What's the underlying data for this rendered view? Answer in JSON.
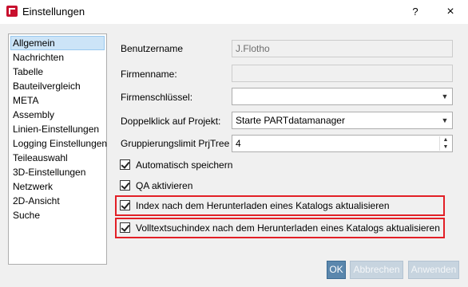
{
  "window": {
    "title": "Einstellungen",
    "help": "?",
    "close": "×"
  },
  "sidebar": {
    "items": [
      {
        "label": "Allgemein",
        "selected": true
      },
      {
        "label": "Nachrichten"
      },
      {
        "label": "Tabelle"
      },
      {
        "label": "Bauteilvergleich"
      },
      {
        "label": "META"
      },
      {
        "label": "Assembly"
      },
      {
        "label": "Linien-Einstellungen"
      },
      {
        "label": "Logging Einstellungen"
      },
      {
        "label": "Teileauswahl"
      },
      {
        "label": "3D-Einstellungen"
      },
      {
        "label": "Netzwerk"
      },
      {
        "label": "2D-Ansicht"
      },
      {
        "label": "Suche"
      }
    ]
  },
  "form": {
    "username_label": "Benutzername",
    "username_value": "J.Flotho",
    "firmname_label": "Firmenname:",
    "firmname_value": "",
    "firmkey_label": "Firmenschlüssel:",
    "firmkey_value": "",
    "doubleclick_label": "Doppelklick auf Projekt:",
    "doubleclick_value": "Starte PARTdatamanager",
    "grouplimit_label": "Gruppierungslimit PrjTree",
    "grouplimit_value": "4"
  },
  "checks": {
    "autosave": "Automatisch speichern",
    "qa": "QA aktivieren",
    "index_update": "Index nach dem Herunterladen eines Katalogs aktualisieren",
    "fulltext_update": "Volltextsuchindex nach dem Herunterladen eines Katalogs aktualisieren"
  },
  "buttons": {
    "ok": "OK",
    "cancel": "Abbrechen",
    "apply": "Anwenden"
  },
  "colors": {
    "highlight": "#e21f26",
    "ok_button": "#5b87ad",
    "selected_item": "#cce4f7"
  },
  "icons": {
    "combo": "chevron-down-icon",
    "spin": "spin-arrows-icon"
  }
}
